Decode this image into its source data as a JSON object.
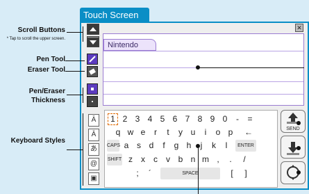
{
  "title": "Touch Screen",
  "callouts": {
    "scroll": "Scroll Buttons",
    "scroll_note": "* Tap to scroll the upper screen.",
    "pen": "Pen Tool",
    "eraser": "Eraser Tool",
    "thickness": "Pen/Eraser Thickness",
    "keyboard_styles": "Keyboard Styles"
  },
  "note_tab_label": "Nintendo",
  "keyboard": {
    "row1": [
      "1",
      "2",
      "3",
      "4",
      "5",
      "6",
      "7",
      "8",
      "9",
      "0",
      "-",
      "="
    ],
    "row2": [
      "q",
      "w",
      "e",
      "r",
      "t",
      "y",
      "u",
      "i",
      "o",
      "p",
      "←"
    ],
    "caps_label": "CAPS",
    "row3": [
      "a",
      "s",
      "d",
      "f",
      "g",
      "h",
      "j",
      "k",
      "l"
    ],
    "enter_label": "ENTER",
    "shift_label": "SHIFT",
    "row4": [
      "z",
      "x",
      "c",
      "v",
      "b",
      "n",
      "m",
      ",",
      "."
    ],
    "row4_extra": "/",
    "row5": [
      ";",
      "´"
    ],
    "space_label": "SPACE",
    "row5_extra": [
      "[",
      "]"
    ]
  },
  "style_buttons": [
    "Ā",
    "Ā",
    "あ",
    "@",
    "▣"
  ],
  "right_buttons": {
    "send_label": "SEND"
  },
  "close_glyph": "✕",
  "colors": {
    "accent": "#0a8ec6",
    "line": "#b9a4e4",
    "pen": "#5c3bbf"
  }
}
